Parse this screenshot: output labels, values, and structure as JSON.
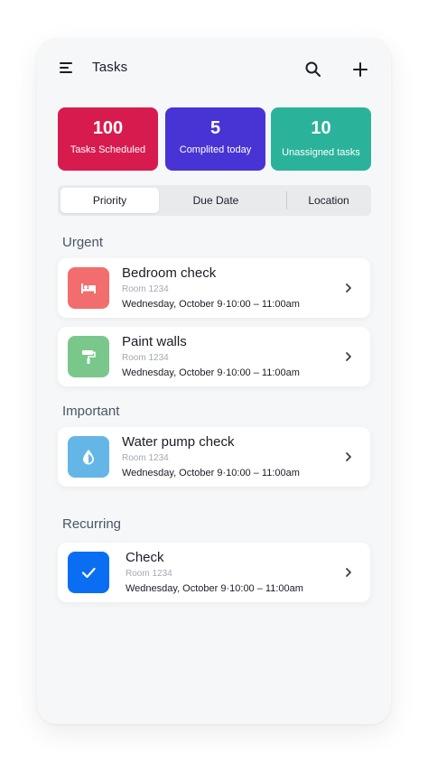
{
  "header": {
    "title": "Tasks",
    "menu_icon": "menu-icon",
    "search_icon": "search-icon",
    "add_icon": "plus-icon"
  },
  "stats": [
    {
      "value": "100",
      "label": "Tasks Scheduled",
      "color": "#d81b4f"
    },
    {
      "value": "5",
      "label": "Complited today",
      "color": "#4834d4"
    },
    {
      "value": "10",
      "label": "Unassigned tasks",
      "color": "#2ab39a"
    }
  ],
  "tabs": [
    {
      "label": "Priority",
      "active": true
    },
    {
      "label": "Due Date",
      "active": false
    },
    {
      "label": "Location",
      "active": false
    }
  ],
  "sections": {
    "urgent": "Urgent",
    "important": "Important",
    "recurring": "Recurring"
  },
  "tasks": [
    {
      "title": "Bedroom check",
      "room": "Room 1234",
      "when": "Wednesday, October 9·10:00 – 11:00am",
      "icon": "bed-icon",
      "color": "#f26d6d"
    },
    {
      "title": "Paint walls",
      "room": "Room 1234",
      "when": "Wednesday, October 9·10:00 – 11:00am",
      "icon": "paint-roller-icon",
      "color": "#7ac78c"
    },
    {
      "title": "Water pump check",
      "room": "Room 1234",
      "when": "Wednesday, October 9·10:00 – 11:00am",
      "icon": "water-drop-icon",
      "color": "#64b6e6"
    },
    {
      "title": "Check",
      "room": "Room 1234",
      "when": "Wednesday, October 9·10:00 – 11:00am",
      "icon": "checkmark-icon",
      "color": "#0a6ef2"
    }
  ]
}
